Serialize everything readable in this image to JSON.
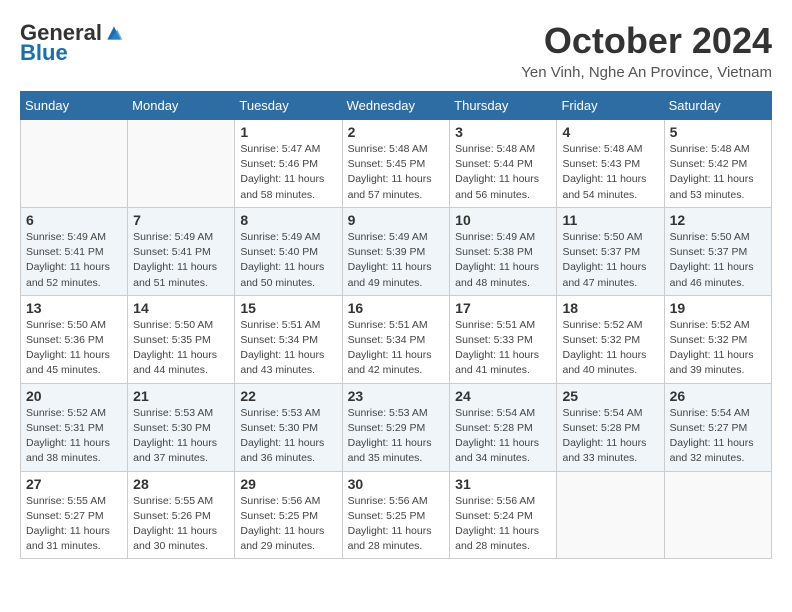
{
  "header": {
    "logo": {
      "general": "General",
      "blue": "Blue"
    },
    "title": "October 2024",
    "location": "Yen Vinh, Nghe An Province, Vietnam"
  },
  "days_of_week": [
    "Sunday",
    "Monday",
    "Tuesday",
    "Wednesday",
    "Thursday",
    "Friday",
    "Saturday"
  ],
  "weeks": [
    [
      {
        "day": "",
        "info": ""
      },
      {
        "day": "",
        "info": ""
      },
      {
        "day": "1",
        "info": "Sunrise: 5:47 AM\nSunset: 5:46 PM\nDaylight: 11 hours and 58 minutes."
      },
      {
        "day": "2",
        "info": "Sunrise: 5:48 AM\nSunset: 5:45 PM\nDaylight: 11 hours and 57 minutes."
      },
      {
        "day": "3",
        "info": "Sunrise: 5:48 AM\nSunset: 5:44 PM\nDaylight: 11 hours and 56 minutes."
      },
      {
        "day": "4",
        "info": "Sunrise: 5:48 AM\nSunset: 5:43 PM\nDaylight: 11 hours and 54 minutes."
      },
      {
        "day": "5",
        "info": "Sunrise: 5:48 AM\nSunset: 5:42 PM\nDaylight: 11 hours and 53 minutes."
      }
    ],
    [
      {
        "day": "6",
        "info": "Sunrise: 5:49 AM\nSunset: 5:41 PM\nDaylight: 11 hours and 52 minutes."
      },
      {
        "day": "7",
        "info": "Sunrise: 5:49 AM\nSunset: 5:41 PM\nDaylight: 11 hours and 51 minutes."
      },
      {
        "day": "8",
        "info": "Sunrise: 5:49 AM\nSunset: 5:40 PM\nDaylight: 11 hours and 50 minutes."
      },
      {
        "day": "9",
        "info": "Sunrise: 5:49 AM\nSunset: 5:39 PM\nDaylight: 11 hours and 49 minutes."
      },
      {
        "day": "10",
        "info": "Sunrise: 5:49 AM\nSunset: 5:38 PM\nDaylight: 11 hours and 48 minutes."
      },
      {
        "day": "11",
        "info": "Sunrise: 5:50 AM\nSunset: 5:37 PM\nDaylight: 11 hours and 47 minutes."
      },
      {
        "day": "12",
        "info": "Sunrise: 5:50 AM\nSunset: 5:37 PM\nDaylight: 11 hours and 46 minutes."
      }
    ],
    [
      {
        "day": "13",
        "info": "Sunrise: 5:50 AM\nSunset: 5:36 PM\nDaylight: 11 hours and 45 minutes."
      },
      {
        "day": "14",
        "info": "Sunrise: 5:50 AM\nSunset: 5:35 PM\nDaylight: 11 hours and 44 minutes."
      },
      {
        "day": "15",
        "info": "Sunrise: 5:51 AM\nSunset: 5:34 PM\nDaylight: 11 hours and 43 minutes."
      },
      {
        "day": "16",
        "info": "Sunrise: 5:51 AM\nSunset: 5:34 PM\nDaylight: 11 hours and 42 minutes."
      },
      {
        "day": "17",
        "info": "Sunrise: 5:51 AM\nSunset: 5:33 PM\nDaylight: 11 hours and 41 minutes."
      },
      {
        "day": "18",
        "info": "Sunrise: 5:52 AM\nSunset: 5:32 PM\nDaylight: 11 hours and 40 minutes."
      },
      {
        "day": "19",
        "info": "Sunrise: 5:52 AM\nSunset: 5:32 PM\nDaylight: 11 hours and 39 minutes."
      }
    ],
    [
      {
        "day": "20",
        "info": "Sunrise: 5:52 AM\nSunset: 5:31 PM\nDaylight: 11 hours and 38 minutes."
      },
      {
        "day": "21",
        "info": "Sunrise: 5:53 AM\nSunset: 5:30 PM\nDaylight: 11 hours and 37 minutes."
      },
      {
        "day": "22",
        "info": "Sunrise: 5:53 AM\nSunset: 5:30 PM\nDaylight: 11 hours and 36 minutes."
      },
      {
        "day": "23",
        "info": "Sunrise: 5:53 AM\nSunset: 5:29 PM\nDaylight: 11 hours and 35 minutes."
      },
      {
        "day": "24",
        "info": "Sunrise: 5:54 AM\nSunset: 5:28 PM\nDaylight: 11 hours and 34 minutes."
      },
      {
        "day": "25",
        "info": "Sunrise: 5:54 AM\nSunset: 5:28 PM\nDaylight: 11 hours and 33 minutes."
      },
      {
        "day": "26",
        "info": "Sunrise: 5:54 AM\nSunset: 5:27 PM\nDaylight: 11 hours and 32 minutes."
      }
    ],
    [
      {
        "day": "27",
        "info": "Sunrise: 5:55 AM\nSunset: 5:27 PM\nDaylight: 11 hours and 31 minutes."
      },
      {
        "day": "28",
        "info": "Sunrise: 5:55 AM\nSunset: 5:26 PM\nDaylight: 11 hours and 30 minutes."
      },
      {
        "day": "29",
        "info": "Sunrise: 5:56 AM\nSunset: 5:25 PM\nDaylight: 11 hours and 29 minutes."
      },
      {
        "day": "30",
        "info": "Sunrise: 5:56 AM\nSunset: 5:25 PM\nDaylight: 11 hours and 28 minutes."
      },
      {
        "day": "31",
        "info": "Sunrise: 5:56 AM\nSunset: 5:24 PM\nDaylight: 11 hours and 28 minutes."
      },
      {
        "day": "",
        "info": ""
      },
      {
        "day": "",
        "info": ""
      }
    ]
  ]
}
